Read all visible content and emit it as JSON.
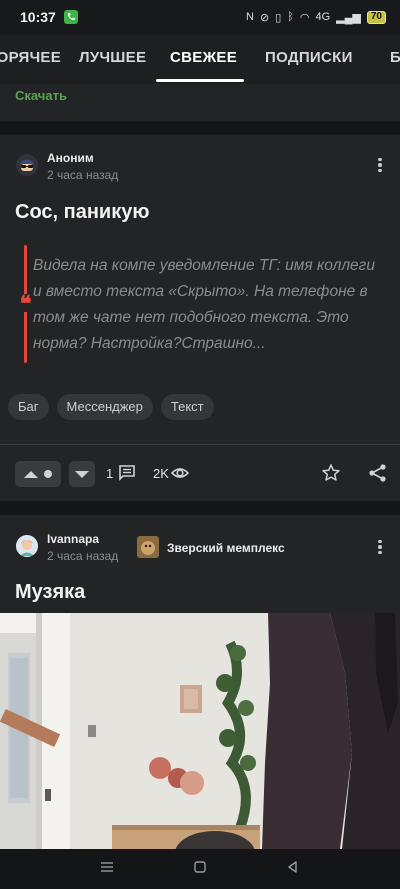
{
  "status_bar": {
    "time": "10:37",
    "battery": "70",
    "network": "4G"
  },
  "tabs": [
    {
      "label": "ГОРЯЧЕЕ",
      "active": false
    },
    {
      "label": "ЛУЧШЕЕ",
      "active": false
    },
    {
      "label": "СВЕЖЕЕ",
      "active": true
    },
    {
      "label": "ПОДПИСКИ",
      "active": false
    },
    {
      "label": "БЛОГИ",
      "active": false
    }
  ],
  "previous_post": {
    "download_label": "Скачать"
  },
  "post1": {
    "author": "Аноним",
    "time_ago": "2 часа назад",
    "title": "Сос, паникую",
    "quote": "Видела на компе уведомление ТГ: имя коллеги и вместо текста «Скрыто». На телефоне в том же чате нет подобного текста. Это норма? Настройка?Страшно...",
    "tags": [
      "Баг",
      "Мессенджер",
      "Текст"
    ],
    "comments_count": "1",
    "views_count": "2K"
  },
  "post2": {
    "author": "Ivannapa",
    "time_ago": "2 часа назад",
    "community": "Зверский мемплекс",
    "title": "Музяка"
  },
  "colors": {
    "accent_red": "#e5473a",
    "download_green": "#5aa34e",
    "background": "#1a1b1d",
    "card": "#232426"
  },
  "icons": [
    "phone-call-icon",
    "more-vert-icon",
    "upvote-icon",
    "downvote-icon",
    "comment-icon",
    "eye-icon",
    "star-icon",
    "share-icon",
    "menu-nav-icon",
    "home-nav-icon",
    "back-nav-icon"
  ]
}
